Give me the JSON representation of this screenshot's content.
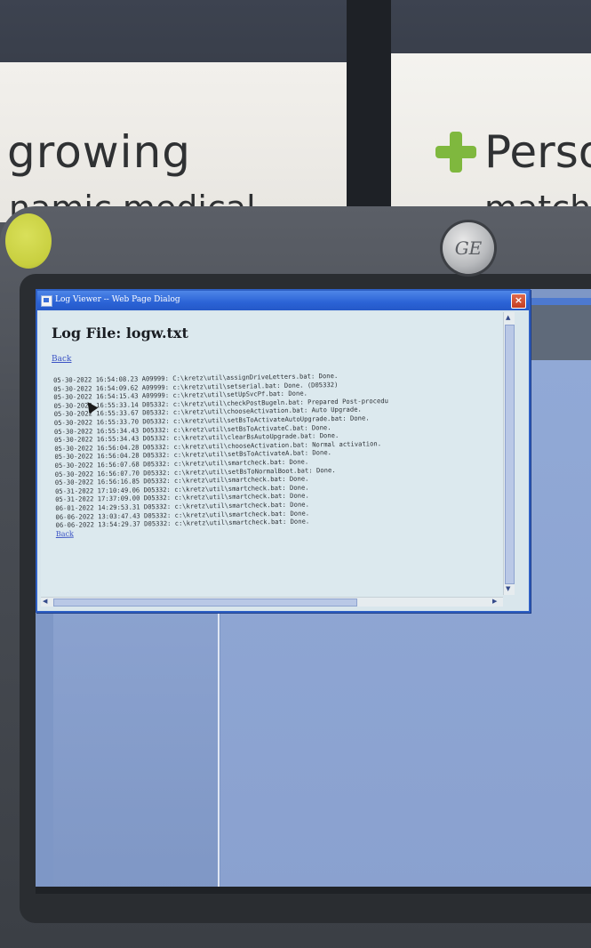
{
  "background": {
    "banner_left_word": "growing",
    "banner_right_word": "Perso",
    "banner_left_sub": "namic medical",
    "banner_right_sub": "match"
  },
  "monitor": {
    "logo_text": "GE"
  },
  "dialog": {
    "title": "Log Viewer -- Web Page Dialog",
    "close_label": "×",
    "page_heading": "Log File: logw.txt",
    "back_top_label": "Back",
    "back_bottom_label": "Back",
    "log_lines": [
      "05-30-2022 16:54:08.23 A09999: C:\\kretz\\util\\assignDriveLetters.bat: Done.",
      "05-30-2022 16:54:09.62 A09999: c:\\kretz\\util\\setserial.bat: Done. (D05332)",
      "05-30-2022 16:54:15.43 A09999: c:\\kretz\\util\\setUpSvcPf.bat: Done.",
      "05-30-2022 16:55:33.14 D05332: c:\\kretz\\util\\checkPostBugeln.bat: Prepared Post-procedu",
      "05-30-2022 16:55:33.67 D05332: c:\\kretz\\util\\chooseActivation.bat: Auto Upgrade.",
      "05-30-2022 16:55:33.70 D05332: c:\\kretz\\util\\setBsToActivateAutoUpgrade.bat: Done.",
      "05-30-2022 16:55:34.43 D05332: c:\\kretz\\util\\setBsToActivateC.bat: Done.",
      "05-30-2022 16:55:34.43 D05332: c:\\kretz\\util\\clearBsAutoUpgrade.bat: Done.",
      "05-30-2022 16:56:04.28 D05332: c:\\kretz\\util\\chooseActivation.bat: Normal activation.",
      "05-30-2022 16:56:04.28 D05332: c:\\kretz\\util\\setBsToActivateA.bat: Done.",
      "05-30-2022 16:56:07.68 D05332: c:\\kretz\\util\\smartcheck.bat: Done.",
      "05-30-2022 16:56:07.70 D05332: c:\\kretz\\util\\setBsToNormalBoot.bat: Done.",
      "05-30-2022 16:56:16.85 D05332: c:\\kretz\\util\\smartcheck.bat: Done.",
      "05-31-2022 17:10:49.06 D05332: c:\\kretz\\util\\smartcheck.bat: Done.",
      "05-31-2022 17:37:09.00 D05332: c:\\kretz\\util\\smartcheck.bat: Done.",
      "06-01-2022 14:29:53.31 D05332: c:\\kretz\\util\\smartcheck.bat: Done.",
      "06-06-2022 13:03:47.43 D05332: c:\\kretz\\util\\smartcheck.bat: Done.",
      "06-06-2022 13:54:29.37 D05332: c:\\kretz\\util\\smartcheck.bat: Done."
    ]
  }
}
